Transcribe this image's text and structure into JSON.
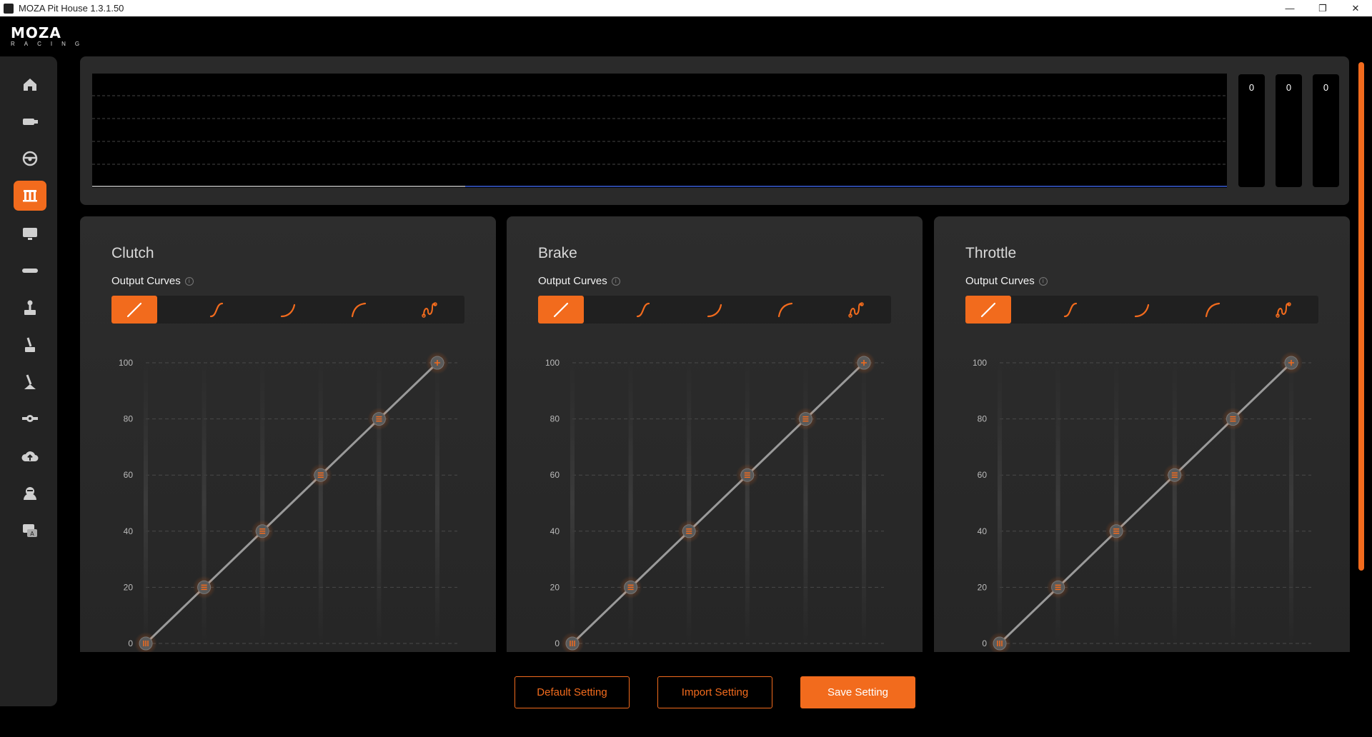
{
  "window": {
    "title": "MOZA Pit House 1.3.1.50",
    "controls": {
      "minimize": "—",
      "maximize": "❐",
      "close": "✕"
    }
  },
  "brand": {
    "name": "MOZA",
    "sub": "RACING"
  },
  "sidebar": {
    "items": [
      {
        "icon": "home-icon",
        "active": false
      },
      {
        "icon": "wheelbase-icon",
        "active": false
      },
      {
        "icon": "steering-wheel-icon",
        "active": false
      },
      {
        "icon": "pedals-icon",
        "active": true
      },
      {
        "icon": "dashboard-display-icon",
        "active": false
      },
      {
        "icon": "handbrake-bar-icon",
        "active": false
      },
      {
        "icon": "shifter-icon",
        "active": false
      },
      {
        "icon": "sequential-shifter-icon",
        "active": false
      },
      {
        "icon": "handbrake-lever-icon",
        "active": false
      },
      {
        "icon": "hub-icon",
        "active": false
      },
      {
        "icon": "firmware-upload-icon",
        "active": false
      },
      {
        "icon": "account-icon",
        "active": false
      },
      {
        "icon": "support-chat-icon",
        "active": false
      }
    ]
  },
  "graph": {
    "meters": [
      "0",
      "0",
      "0"
    ]
  },
  "panels": [
    {
      "title": "Clutch",
      "output_curves_label": "Output Curves",
      "selected_curve": 0
    },
    {
      "title": "Brake",
      "output_curves_label": "Output Curves",
      "selected_curve": 0
    },
    {
      "title": "Throttle",
      "output_curves_label": "Output Curves",
      "selected_curve": 0
    }
  ],
  "curve_types": [
    "linear-curve-icon",
    "s-curve-icon",
    "exponential-curve-icon",
    "logarithmic-curve-icon",
    "custom-curve-icon"
  ],
  "chart_data": [
    {
      "type": "line",
      "title": "",
      "x": [
        0,
        20,
        40,
        60,
        80,
        100
      ],
      "y": [
        0,
        20,
        40,
        60,
        80,
        100
      ],
      "ylim": [
        0,
        100
      ],
      "yticks": [
        "0",
        "20",
        "40",
        "60",
        "80",
        "100"
      ]
    },
    {
      "type": "line",
      "title": "",
      "x": [
        0,
        20,
        40,
        60,
        80,
        100
      ],
      "y": [
        0,
        20,
        40,
        60,
        80,
        100
      ],
      "ylim": [
        0,
        100
      ],
      "yticks": [
        "0",
        "20",
        "40",
        "60",
        "80",
        "100"
      ]
    },
    {
      "type": "line",
      "title": "",
      "x": [
        0,
        20,
        40,
        60,
        80,
        100
      ],
      "y": [
        0,
        20,
        40,
        60,
        80,
        100
      ],
      "ylim": [
        0,
        100
      ],
      "yticks": [
        "0",
        "20",
        "40",
        "60",
        "80",
        "100"
      ]
    }
  ],
  "buttons": {
    "default": "Default Setting",
    "import": "Import Setting",
    "save": "Save Setting"
  },
  "colors": {
    "accent": "#f26b1d",
    "panel": "#2a2a2a",
    "sidebar": "#232323"
  }
}
